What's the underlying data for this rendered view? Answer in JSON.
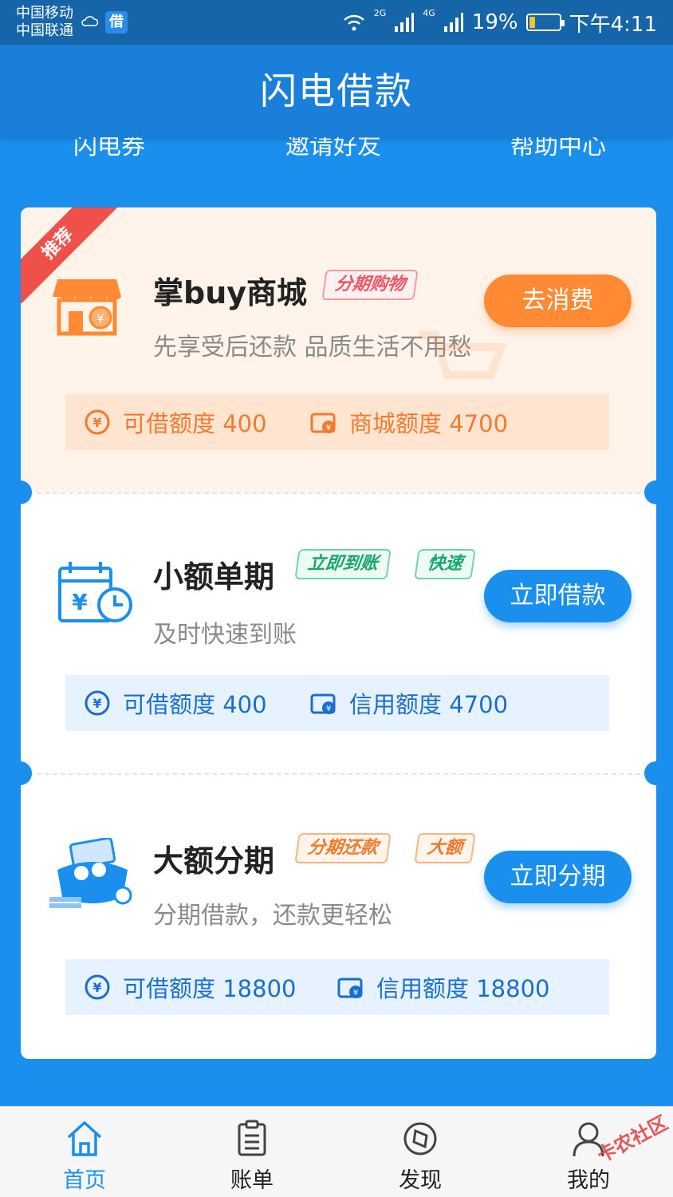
{
  "status_bar": {
    "carrier1": "中国移动",
    "carrier2": "中国联通",
    "app_badge": "借",
    "net1": "2G",
    "net2": "4G",
    "battery": "19%",
    "battery_level": 0.19,
    "time": "下午4:11"
  },
  "header": {
    "title": "闪电借款"
  },
  "quick_nav": [
    "闪电券",
    "邀请好友",
    "帮助中心"
  ],
  "products": [
    {
      "ribbon": "推荐",
      "name": "掌buy商城",
      "tags": [
        "分期购物"
      ],
      "desc": "先享受后还款 品质生活不用愁",
      "button": "去消费",
      "limits": [
        {
          "label": "可借额度 400"
        },
        {
          "label": "商城额度 4700"
        }
      ],
      "accent": "#ff8a33"
    },
    {
      "name": "小额单期",
      "tags": [
        "立即到账",
        "快速"
      ],
      "desc": "及时快速到账",
      "button": "立即借款",
      "limits": [
        {
          "label": "可借额度 400"
        },
        {
          "label": "信用额度 4700"
        }
      ],
      "accent": "#1a8fee"
    },
    {
      "name": "大额分期",
      "tags": [
        "分期还款",
        "大额"
      ],
      "desc": "分期借款，还款更轻松",
      "button": "立即分期",
      "limits": [
        {
          "label": "可借额度 18800"
        },
        {
          "label": "信用额度 18800"
        }
      ],
      "accent": "#1a8fee"
    }
  ],
  "bottom_nav": [
    {
      "label": "首页",
      "icon": "home-icon",
      "active": true
    },
    {
      "label": "账单",
      "icon": "bill-icon",
      "active": false
    },
    {
      "label": "发现",
      "icon": "compass-icon",
      "active": false
    },
    {
      "label": "我的",
      "icon": "user-icon",
      "active": false
    }
  ],
  "watermark": "卡农社区",
  "colors": {
    "primary": "#1a8fee",
    "header": "#1a7fd8",
    "orange": "#ff8a33"
  }
}
